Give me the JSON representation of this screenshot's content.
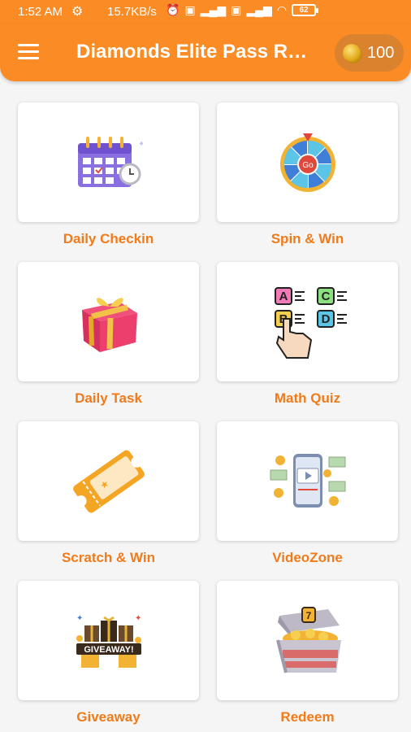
{
  "status_bar": {
    "time": "1:52 AM",
    "net_speed": "15.7KB/s",
    "battery": "62"
  },
  "app_bar": {
    "title": "Diamonds Elite Pass Rewards",
    "coins": "100"
  },
  "menu": [
    {
      "label": "Daily Checkin",
      "icon": "calendar-icon"
    },
    {
      "label": "Spin & Win",
      "icon": "spin-wheel-icon"
    },
    {
      "label": "Daily Task",
      "icon": "gift-box-icon"
    },
    {
      "label": "Math Quiz",
      "icon": "quiz-abcd-icon"
    },
    {
      "label": "Scratch & Win",
      "icon": "ticket-icon"
    },
    {
      "label": "VideoZone",
      "icon": "video-phone-icon"
    },
    {
      "label": "Giveaway",
      "icon": "giveaway-icon"
    },
    {
      "label": "Redeem",
      "icon": "treasure-chest-icon"
    }
  ],
  "colors": {
    "primary": "#fb8b24",
    "label": "#ef7b1a"
  }
}
